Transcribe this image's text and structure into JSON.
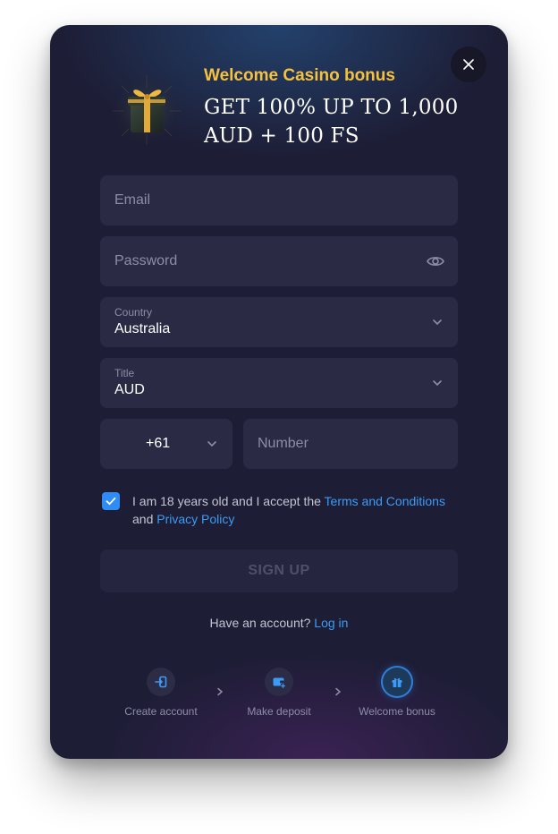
{
  "bonus": {
    "label": "Welcome Casino bonus",
    "headline": "GET 100% UP TO 1,000 AUD + 100 FS"
  },
  "form": {
    "email": {
      "placeholder": "Email",
      "value": ""
    },
    "password": {
      "placeholder": "Password",
      "value": ""
    },
    "country": {
      "label": "Country",
      "value": "Australia"
    },
    "currency": {
      "label": "Title",
      "value": "AUD"
    },
    "phone": {
      "code": "+61",
      "placeholder": "Number",
      "value": ""
    },
    "consent": {
      "checked": true,
      "text_before": "I am 18 years old and I accept the ",
      "terms_link": "Terms and Conditions",
      "text_middle": " and ",
      "privacy_link": "Privacy Policy"
    },
    "signup_label": "SIGN UP",
    "login_prompt": "Have an account?",
    "login_link": "Log in"
  },
  "steps": [
    {
      "label": "Create account",
      "icon": "login-arrow-icon",
      "active": false
    },
    {
      "label": "Make deposit",
      "icon": "wallet-plus-icon",
      "active": false
    },
    {
      "label": "Welcome bonus",
      "icon": "gift-icon",
      "active": true
    }
  ],
  "colors": {
    "modal_bg": "#1d1d35",
    "field_bg": "#2a2a45",
    "accent_gold": "#f5c13f",
    "link_blue": "#3c9bf6",
    "checkbox_blue": "#2f8cf4"
  }
}
